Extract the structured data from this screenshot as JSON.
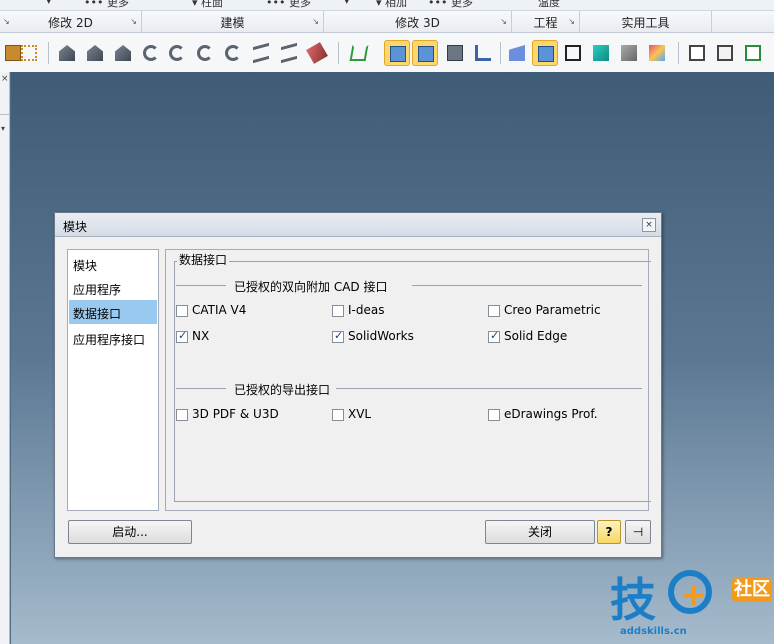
{
  "ribbon": {
    "top_row_labels": [
      "▾",
      "••• 更多",
      "▾ 柱面",
      "••• 更多",
      "▾",
      "▾ 相加",
      "••• 更多",
      "温度"
    ],
    "groups": [
      {
        "label": "修改 2D"
      },
      {
        "label": "建模"
      },
      {
        "label": "修改 3D"
      },
      {
        "label": "工程"
      },
      {
        "label": "实用工具"
      }
    ]
  },
  "left_strip": {
    "close_glyph": "×",
    "chevron_glyph": "▾"
  },
  "dialog": {
    "title": "模块",
    "close_glyph": "×",
    "nav_items": [
      "模块",
      "应用程序",
      "数据接口",
      "应用程序接口"
    ],
    "selected_nav": "数据接口",
    "panel_title": "数据接口",
    "section_cad": {
      "label": "已授权的双向附加 CAD 接口",
      "options": [
        {
          "label": "CATIA V4",
          "checked": false
        },
        {
          "label": "I-deas",
          "checked": false
        },
        {
          "label": "Creo Parametric",
          "checked": false
        },
        {
          "label": "NX",
          "checked": true
        },
        {
          "label": "SolidWorks",
          "checked": true
        },
        {
          "label": "Solid Edge",
          "checked": true
        }
      ]
    },
    "section_export": {
      "label": "已授权的导出接口",
      "options": [
        {
          "label": "3D PDF & U3D",
          "checked": false
        },
        {
          "label": "XVL",
          "checked": false
        },
        {
          "label": "eDrawings Prof.",
          "checked": false
        }
      ]
    },
    "buttons": {
      "start": "启动...",
      "close": "关闭",
      "help_glyph": "?",
      "pin_glyph": "⊣"
    }
  },
  "watermark": {
    "char1": "技",
    "plus": "+",
    "badge": "社区",
    "url": "addskills.cn"
  },
  "check_glyph": "✓"
}
